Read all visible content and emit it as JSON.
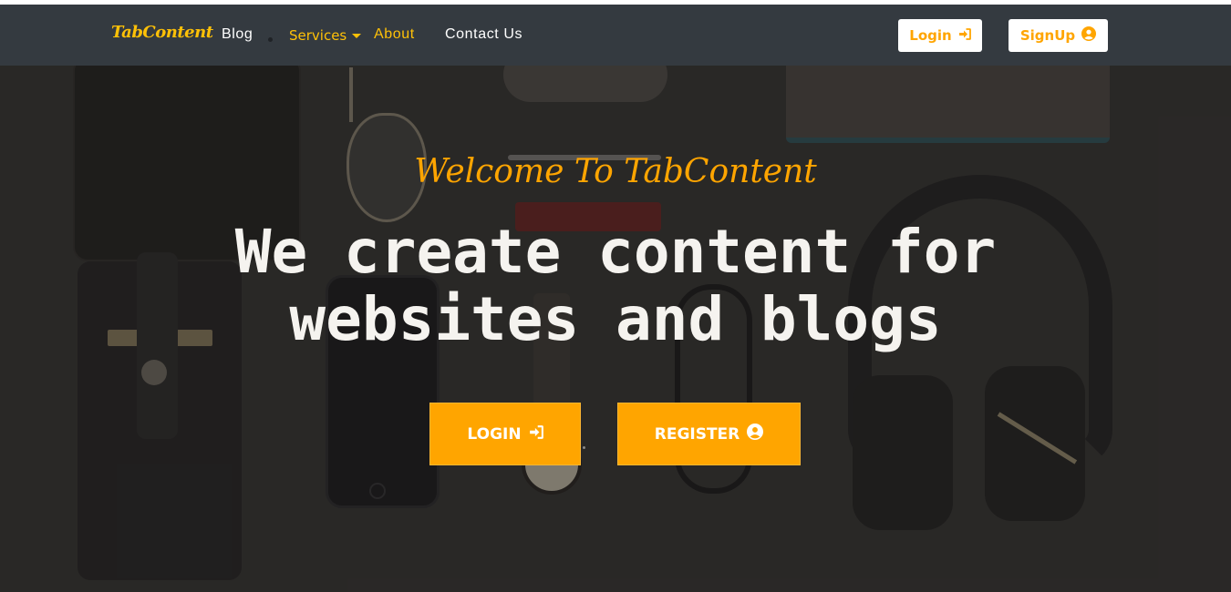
{
  "navbar": {
    "brand": "TabContent",
    "links": {
      "blog": "Blog",
      "services": "Services",
      "about": "About",
      "contact": "Contact Us"
    },
    "login_label": "Login",
    "signup_label": "SignUp"
  },
  "hero": {
    "welcome": "Welcome To TabContent",
    "headline_line1": "We create content for",
    "headline_line2": "websites and blogs",
    "login_label": "LOGIN",
    "register_label": "REGISTER"
  },
  "colors": {
    "accent": "#ffa500",
    "brand": "#ffc107",
    "navbar_bg": "#343a40"
  },
  "icons": {
    "login": "sign-in-icon",
    "signup": "user-circle-icon"
  }
}
